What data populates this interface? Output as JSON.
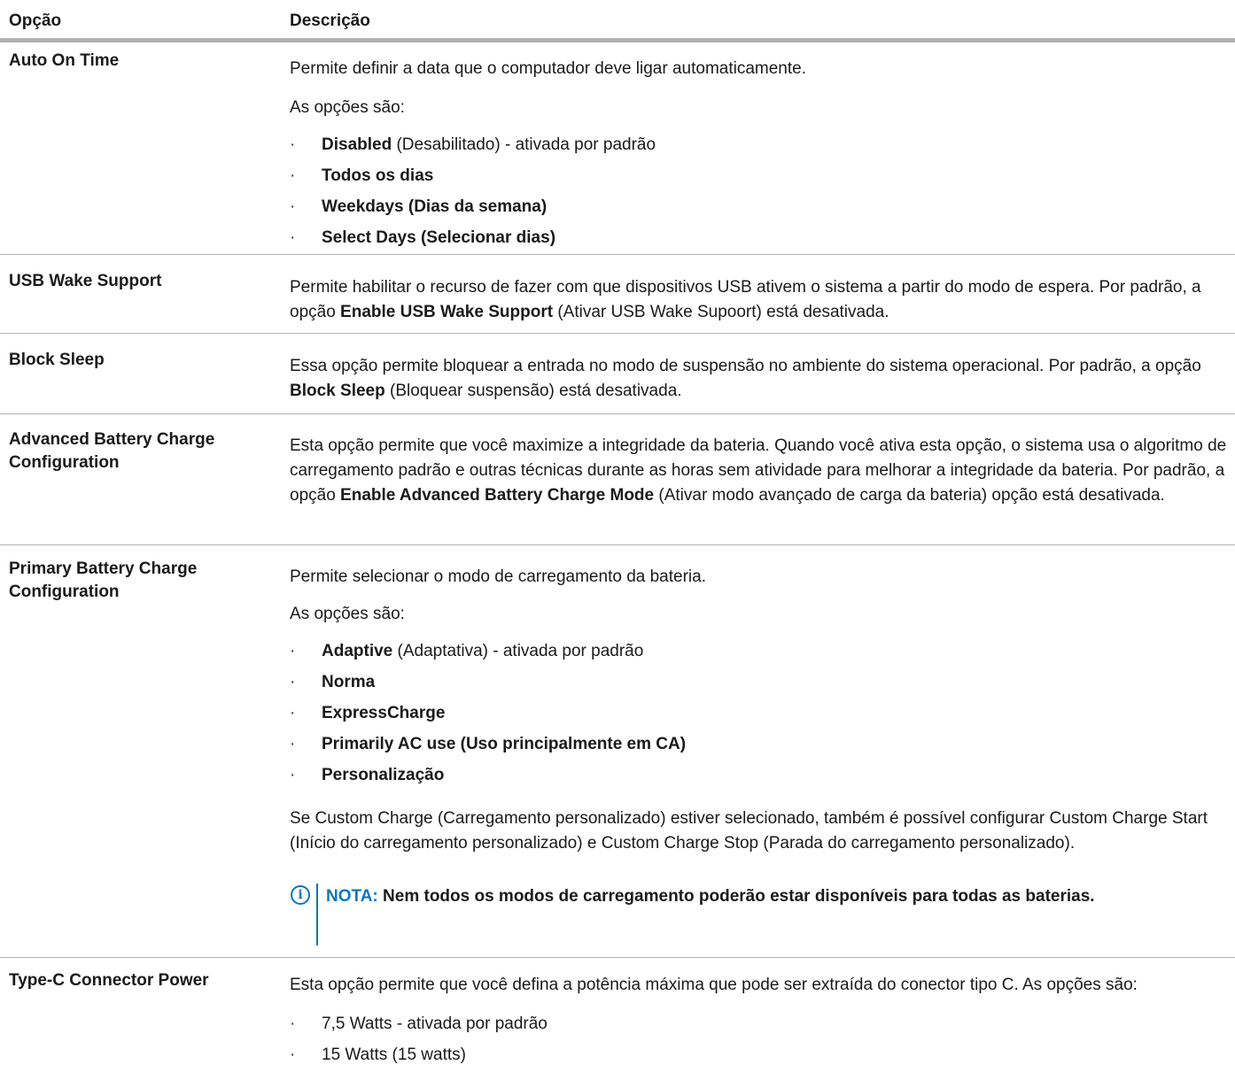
{
  "header": {
    "col_option": "Opção",
    "col_description": "Descrição"
  },
  "rows": {
    "auto_on": {
      "option": "Auto On Time",
      "desc": "Permite definir a data que o computador deve ligar automaticamente.",
      "intro": "As opções são:",
      "items": [
        {
          "bold": "Disabled",
          "rest": " (Desabilitado) - ativada por padrão"
        },
        {
          "bold": "Todos os dias",
          "rest": ""
        },
        {
          "bold": "Weekdays (Dias da semana)",
          "rest": ""
        },
        {
          "bold": "Select Days (Selecionar dias)",
          "rest": ""
        }
      ]
    },
    "usb_wake": {
      "option": "USB Wake Support",
      "pre": "Permite habilitar o recurso de fazer com que dispositivos USB ativem o sistema a partir do modo de espera. Por padrão, a opção ",
      "bold": "Enable USB Wake Support",
      "post": " (Ativar USB Wake Supoort) está desativada."
    },
    "block_sleep": {
      "option": "Block Sleep",
      "pre": "Essa opção permite bloquear a entrada no modo de suspensão no ambiente do sistema operacional. Por padrão, a opção ",
      "bold": "Block Sleep",
      "post": " (Bloquear suspensão) está desativada."
    },
    "adv_battery": {
      "option": "Advanced Battery Charge Configuration",
      "pre": "Esta opção permite que você maximize a integridade da bateria. Quando você ativa esta opção, o sistema usa o algoritmo de carregamento padrão e outras técnicas durante as horas sem atividade para melhorar a integridade da bateria. Por padrão, a opção ",
      "bold": "Enable Advanced Battery Charge Mode",
      "post": " (Ativar modo avançado de carga da bateria) opção está desativada."
    },
    "primary_battery": {
      "option": "Primary Battery Charge Configuration",
      "desc": "Permite selecionar o modo de carregamento da bateria.",
      "intro": "As opções são:",
      "items": [
        {
          "bold": "Adaptive",
          "rest": " (Adaptativa) - ativada por padrão"
        },
        {
          "bold": "Norma",
          "rest": ""
        },
        {
          "bold": "ExpressCharge",
          "rest": ""
        },
        {
          "bold": "Primarily AC use (Uso principalmente em CA)",
          "rest": ""
        },
        {
          "bold": "Personalização",
          "rest": ""
        }
      ],
      "after": "Se Custom Charge (Carregamento personalizado) estiver selecionado, também é possível configurar Custom Charge Start (Início do carregamento personalizado) e Custom Charge Stop (Parada do carregamento personalizado).",
      "note_label": "NOTA:",
      "note_text": " Nem todos os modos de carregamento poderão estar disponíveis para todas as baterias."
    },
    "type_c": {
      "option": "Type-C Connector Power",
      "desc": "Esta opção permite que você defina a potência máxima que pode ser extraída do conector tipo C. As opções são:",
      "items": [
        "7,5 Watts - ativada por padrão",
        "15 Watts (15 watts)"
      ]
    }
  }
}
